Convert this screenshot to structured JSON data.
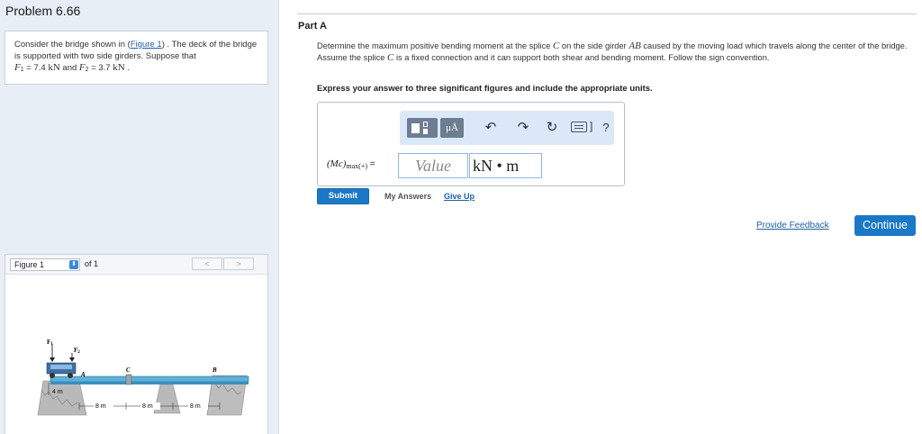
{
  "problem": {
    "title": "Problem 6.66"
  },
  "intro": {
    "text_a": "Consider the bridge shown in (",
    "figure_link": "Figure 1",
    "text_b": ") . The deck of the bridge is supported with two side girders. Suppose that",
    "f1_symbol": "F",
    "f1_sub": "1",
    "f1_eq": " = 7.4 ",
    "f1_unit": "kN",
    "and": " and ",
    "f2_symbol": "F",
    "f2_sub": "2",
    "f2_eq": " = 3.7 ",
    "f2_unit": "kN",
    "end": " ."
  },
  "figure_panel": {
    "select_value": "Figure 1",
    "of_text": "of 1",
    "prev": "<",
    "next": ">",
    "labels": {
      "f1": "F",
      "f1_sub": "1",
      "f2": "F",
      "f2_sub": "2",
      "a": "A",
      "b": "B",
      "c": "C",
      "dim_4m": "4 m",
      "dim_8m_1": "8 m",
      "dim_8m_2": "8 m",
      "dim_8m_3": "8 m"
    }
  },
  "part": {
    "title": "Part A"
  },
  "question": {
    "text_1": "Determine the maximum positive bending moment at the splice ",
    "c": "C",
    "text_2": " on the side girder ",
    "ab": "AB",
    "text_3": " caused by the moving load which travels along the center of the bridge. Assume the splice ",
    "c2": "C",
    "text_4": " is a fixed connection and it can support both shear and bending moment. Follow the sign convention."
  },
  "instruction": "Express your answer to three significant figures and include the appropriate units.",
  "answer": {
    "var_main": "(Mc)",
    "var_sub": "max(+)",
    "eq": " =",
    "value_placeholder": "Value",
    "units": "kN • m",
    "unit_button": "μÅ",
    "help": "?"
  },
  "actions": {
    "submit": "Submit",
    "my_answers": "My Answers",
    "give_up": "Give Up",
    "feedback": "Provide Feedback",
    "continue": "Continue"
  },
  "colors": {
    "accent": "#1b78c7",
    "link": "#1f5fa8",
    "panel_bg": "#e8eef6",
    "toolbar_bg": "#dbe8f8"
  }
}
